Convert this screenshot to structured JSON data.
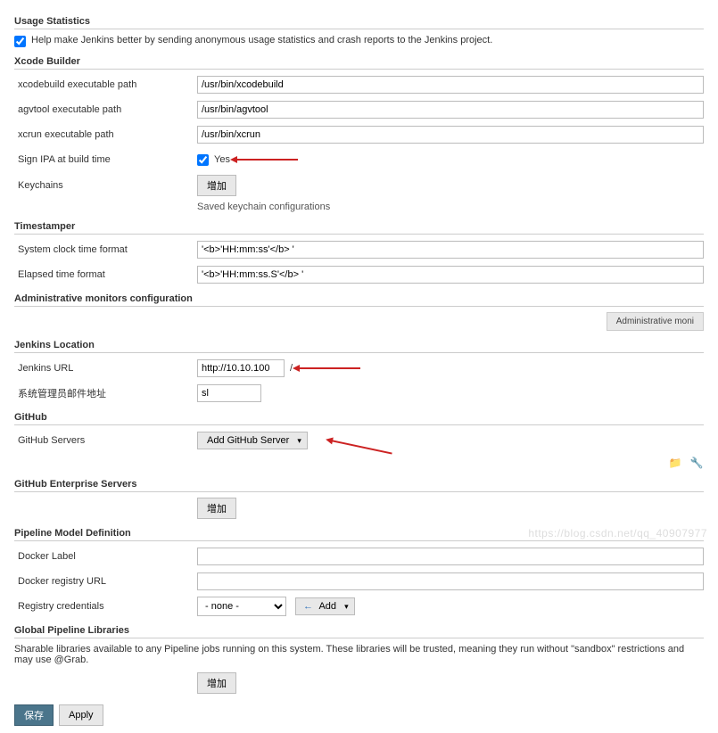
{
  "usage_stats": {
    "header": "Usage Statistics",
    "help_text": "Help make Jenkins better by sending anonymous usage statistics and crash reports to the Jenkins project."
  },
  "xcode": {
    "header": "Xcode Builder",
    "xcodebuild_label": "xcodebuild executable path",
    "xcodebuild_value": "/usr/bin/xcodebuild",
    "agvtool_label": "agvtool executable path",
    "agvtool_value": "/usr/bin/agvtool",
    "xcrun_label": "xcrun executable path",
    "xcrun_value": "/usr/bin/xcrun",
    "sign_label": "Sign IPA at build time",
    "sign_yes": "Yes",
    "keychains_label": "Keychains",
    "add_btn": "增加",
    "saved_note": "Saved keychain configurations"
  },
  "timestamper": {
    "header": "Timestamper",
    "clock_label": "System clock time format",
    "clock_value": "'<b>'HH:mm:ss'</b> '",
    "elapsed_label": "Elapsed time format",
    "elapsed_value": "'<b>'HH:mm:ss.S'</b> '"
  },
  "admin_mon": {
    "header": "Administrative monitors configuration",
    "pill": "Administrative moni"
  },
  "jenkins_loc": {
    "header": "Jenkins Location",
    "url_label": "Jenkins URL",
    "url_value": "http://10.10.100",
    "url_suffix": "/",
    "admin_email_label": "系统管理员邮件地址",
    "admin_email_value": "sl"
  },
  "github": {
    "header": "GitHub",
    "servers_label": "GitHub Servers",
    "add_server_btn": "Add GitHub Server"
  },
  "github_enterprise": {
    "header": "GitHub Enterprise Servers",
    "add_btn": "增加"
  },
  "pipeline": {
    "header": "Pipeline Model Definition",
    "docker_label": "Docker Label",
    "registry_url_label": "Docker registry URL",
    "registry_cred_label": "Registry credentials",
    "none_option": "- none -",
    "add_btn": "Add"
  },
  "global_libs": {
    "header": "Global Pipeline Libraries",
    "note": "Sharable libraries available to any Pipeline jobs running on this system. These libraries will be trusted, meaning they run without \"sandbox\" restrictions and may use @Grab.",
    "add_btn": "增加"
  },
  "bottom": {
    "save": "保存",
    "apply": "Apply"
  },
  "watermark": "https://blog.csdn.net/qq_40907977"
}
